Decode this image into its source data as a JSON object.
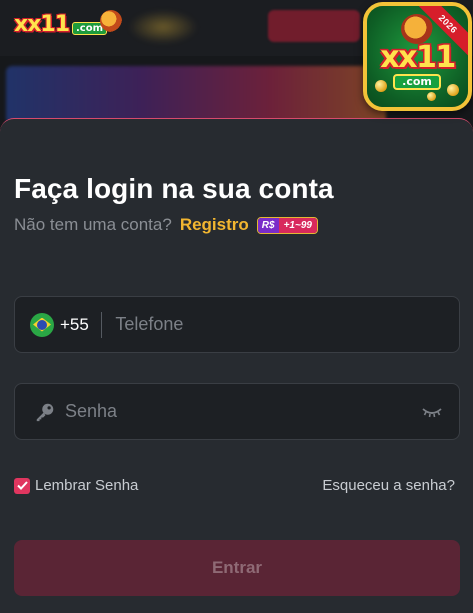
{
  "header": {
    "brand_logo": {
      "name": "xx11",
      "suffix": ".com"
    },
    "app_icon": {
      "name": "xx11",
      "suffix": ".com",
      "year_ribbon": "2026"
    }
  },
  "login": {
    "title": "Faça login na sua conta",
    "no_account_text": "Não tem uma conta?",
    "register_link": "Registro",
    "bonus_badge": {
      "currency": "R$",
      "amount": "+1~99"
    },
    "phone": {
      "country_code": "+55",
      "flag": "brazil-flag-icon",
      "placeholder": "Telefone",
      "value": ""
    },
    "password": {
      "icon": "key-icon",
      "placeholder": "Senha",
      "value": "",
      "toggle_icon": "eye-closed-icon"
    },
    "remember_label": "Lembrar Senha",
    "remember_checked": true,
    "forgot_link": "Esqueceu a senha?",
    "submit_label": "Entrar"
  },
  "colors": {
    "sheet_bg": "#272b30",
    "field_bg": "#1d2024",
    "accent_pink": "#e0365f",
    "register_gold": "#f2b630",
    "submit_bg": "#5a2535",
    "submit_text": "#8f6a75"
  }
}
